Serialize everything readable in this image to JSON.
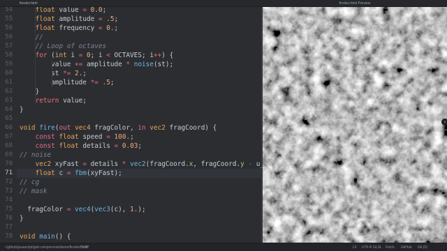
{
  "editor": {
    "tab_title": "firedev.html",
    "lines": [
      {
        "n": "54",
        "html": "    <span class='ty'>float</span> value <span class='op'>=</span> <span class='num'>0.0</span>;"
      },
      {
        "n": "55",
        "html": "    <span class='ty'>float</span> amplitude <span class='op'>=</span> <span class='num'>.5</span>;"
      },
      {
        "n": "56",
        "html": "    <span class='ty'>float</span> frequency <span class='op'>=</span> <span class='num'>0.</span>;"
      },
      {
        "n": "56",
        "html": "    <span class='cm'>//</span>"
      },
      {
        "n": "57",
        "html": "    <span class='cm'>// Loop of octaves</span>"
      },
      {
        "n": "58",
        "html": "    <span class='kw'>for</span> (<span class='ty'>int</span> i <span class='op'>=</span> <span class='num'>0</span>; i <span class='op'>&lt;</span> OCTAVES; i<span class='op'>++</span>) {"
      },
      {
        "n": "59",
        "html": "        value <span class='op'>+=</span> amplitude <span class='op'>*</span> <span class='fn'>noise</span>(st);"
      },
      {
        "n": "60",
        "html": "        st <span class='op'>*=</span> <span class='num'>2.</span>;"
      },
      {
        "n": "61",
        "html": "        amplitude <span class='op'>*=</span> <span class='num'>.5</span>;"
      },
      {
        "n": "62",
        "html": "    }"
      },
      {
        "n": "63",
        "html": "    <span class='kw'>return</span> value;"
      },
      {
        "n": "64",
        "html": "}"
      },
      {
        "n": "65",
        "html": ""
      },
      {
        "n": "66",
        "html": "<span class='ty'>void</span> <span class='fn'>fire</span>(<span class='kw2'>out</span> <span class='ty'>vec4</span> fragColor, <span class='kw2'>in</span> <span class='ty'>vec2</span> fragCoord) {"
      },
      {
        "n": "67",
        "html": "    <span class='kw2'>const</span> <span class='ty'>float</span> speed <span class='op'>=</span> <span class='num'>100.</span>;"
      },
      {
        "n": "68",
        "html": "    <span class='kw2'>const</span> <span class='ty'>float</span> details <span class='op'>=</span> <span class='num'>0.03</span>;"
      },
      {
        "n": "69",
        "html": "<span class='cm'>// noise</span>"
      },
      {
        "n": "70",
        "html": "    <span class='ty'>vec2</span> xyFast <span class='op'>=</span> details <span class='op'>*</span> <span class='fn'>vec2</span>(fragCoord.<span class='sw'>x</span>, fragCoord.<span class='sw'>y</span> <span class='op'>-</span> u_time <span class='op'>*</span>"
      },
      {
        "n": "71",
        "html": "    <span class='ty'>float</span> c <span class='op'>=</span> <span class='fn'>fbm</span>(xyFast);",
        "active": true
      },
      {
        "n": "72",
        "html": "<span class='cm'>// cg</span>"
      },
      {
        "n": "73",
        "html": "<span class='cm'>// mask</span>"
      },
      {
        "n": "74",
        "html": ""
      },
      {
        "n": "75",
        "html": "  fragColor <span class='op'>=</span> <span class='fn'>vec4</span>(<span class='fn'>vec3</span>(c), <span class='num'>1.</span>);"
      },
      {
        "n": "76",
        "html": "}"
      },
      {
        "n": "77",
        "html": ""
      },
      {
        "n": "78",
        "html": "<span class='ty'>void</span> <span class='fn'>main</span>() {"
      }
    ]
  },
  "preview": {
    "title": "firedev.html Preview",
    "collapse_icon": "›"
  },
  "status_bar": {
    "file_path": "~/github/javascript/gist-components/demo/firedev.html*",
    "cursor": "71:30",
    "line_ending": "LF",
    "encoding": "UTF-8",
    "grammar": "GLSL",
    "package": "Fetch",
    "github": "GitHub",
    "git": "Git (0)"
  }
}
